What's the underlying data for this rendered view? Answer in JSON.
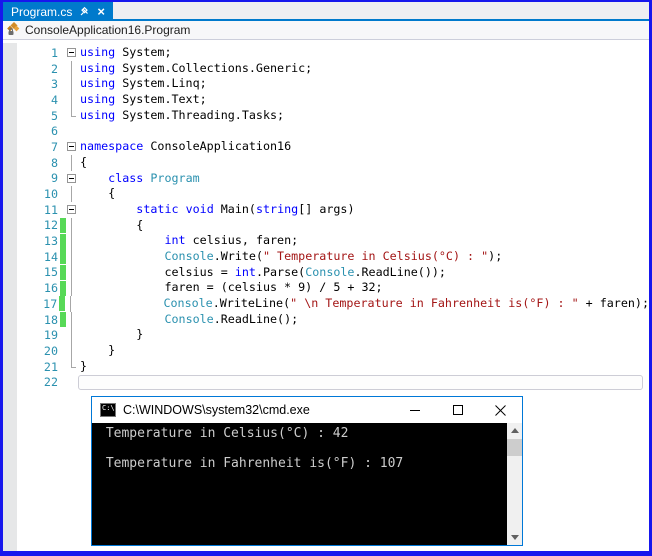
{
  "tab": {
    "label": "Program.cs"
  },
  "breadcrumb": {
    "text": "ConsoleApplication16.Program"
  },
  "colors": {
    "accent_tab": "#007ACC",
    "window_border": "#1717ED",
    "console_border": "#0078D7",
    "keyword": "#0000FF",
    "type": "#2B91AF",
    "string": "#A31515",
    "line_number": "#2B91AF",
    "change_bar": "#57D957",
    "console_text": "#CCCCCC"
  },
  "editor": {
    "lines": [
      {
        "n": "1",
        "fold": "box",
        "tokens": [
          {
            "c": "k",
            "s": "using"
          },
          {
            "c": "p",
            "s": " System;"
          }
        ]
      },
      {
        "n": "2",
        "fold": "v",
        "tokens": [
          {
            "c": "k",
            "s": "using"
          },
          {
            "c": "p",
            "s": " System.Collections.Generic;"
          }
        ]
      },
      {
        "n": "3",
        "fold": "v",
        "tokens": [
          {
            "c": "k",
            "s": "using"
          },
          {
            "c": "p",
            "s": " System.Linq;"
          }
        ]
      },
      {
        "n": "4",
        "fold": "v",
        "tokens": [
          {
            "c": "k",
            "s": "using"
          },
          {
            "c": "p",
            "s": " System.Text;"
          }
        ]
      },
      {
        "n": "5",
        "fold": "end",
        "tokens": [
          {
            "c": "k",
            "s": "using"
          },
          {
            "c": "p",
            "s": " System.Threading.Tasks;"
          }
        ]
      },
      {
        "n": "6",
        "fold": "",
        "tokens": []
      },
      {
        "n": "7",
        "fold": "box",
        "tokens": [
          {
            "c": "k",
            "s": "namespace"
          },
          {
            "c": "p",
            "s": " ConsoleApplication16"
          }
        ]
      },
      {
        "n": "8",
        "fold": "v",
        "tokens": [
          {
            "c": "p",
            "s": "{"
          }
        ]
      },
      {
        "n": "9",
        "fold": "box",
        "tokens": [
          {
            "c": "p",
            "s": "    "
          },
          {
            "c": "k",
            "s": "class"
          },
          {
            "c": "p",
            "s": " "
          },
          {
            "c": "t",
            "s": "Program"
          }
        ]
      },
      {
        "n": "10",
        "fold": "v",
        "tokens": [
          {
            "c": "p",
            "s": "    {"
          }
        ]
      },
      {
        "n": "11",
        "fold": "box",
        "tokens": [
          {
            "c": "p",
            "s": "        "
          },
          {
            "c": "k",
            "s": "static"
          },
          {
            "c": "p",
            "s": " "
          },
          {
            "c": "k",
            "s": "void"
          },
          {
            "c": "p",
            "s": " Main("
          },
          {
            "c": "k",
            "s": "string"
          },
          {
            "c": "p",
            "s": "[] args)"
          }
        ]
      },
      {
        "n": "12",
        "fold": "v",
        "changed": true,
        "tokens": [
          {
            "c": "p",
            "s": "        {"
          }
        ]
      },
      {
        "n": "13",
        "fold": "v",
        "changed": true,
        "tokens": [
          {
            "c": "p",
            "s": "            "
          },
          {
            "c": "k",
            "s": "int"
          },
          {
            "c": "p",
            "s": " celsius, faren;"
          }
        ]
      },
      {
        "n": "14",
        "fold": "v",
        "changed": true,
        "tokens": [
          {
            "c": "p",
            "s": "            "
          },
          {
            "c": "t",
            "s": "Console"
          },
          {
            "c": "p",
            "s": ".Write("
          },
          {
            "c": "s",
            "s": "\" Temperature in Celsius(°C) : \""
          },
          {
            "c": "p",
            "s": ");"
          }
        ]
      },
      {
        "n": "15",
        "fold": "v",
        "changed": true,
        "tokens": [
          {
            "c": "p",
            "s": "            celsius = "
          },
          {
            "c": "k",
            "s": "int"
          },
          {
            "c": "p",
            "s": ".Parse("
          },
          {
            "c": "t",
            "s": "Console"
          },
          {
            "c": "p",
            "s": ".ReadLine());"
          }
        ]
      },
      {
        "n": "16",
        "fold": "v",
        "changed": true,
        "tokens": [
          {
            "c": "p",
            "s": "            faren = (celsius * 9) / 5 + 32;"
          }
        ]
      },
      {
        "n": "17",
        "fold": "v",
        "changed": true,
        "tokens": [
          {
            "c": "p",
            "s": "            "
          },
          {
            "c": "t",
            "s": "Console"
          },
          {
            "c": "p",
            "s": ".WriteLine("
          },
          {
            "c": "s",
            "s": "\" \\n Temperature in Fahrenheit is(°F) : \""
          },
          {
            "c": "p",
            "s": " + faren);"
          }
        ]
      },
      {
        "n": "18",
        "fold": "v",
        "changed": true,
        "tokens": [
          {
            "c": "p",
            "s": "            "
          },
          {
            "c": "t",
            "s": "Console"
          },
          {
            "c": "p",
            "s": ".ReadLine();"
          }
        ]
      },
      {
        "n": "19",
        "fold": "v",
        "tokens": [
          {
            "c": "p",
            "s": "        }"
          }
        ]
      },
      {
        "n": "20",
        "fold": "v",
        "tokens": [
          {
            "c": "p",
            "s": "    }"
          }
        ]
      },
      {
        "n": "21",
        "fold": "end",
        "tokens": [
          {
            "c": "p",
            "s": "}"
          }
        ]
      },
      {
        "n": "22",
        "fold": "",
        "current": true,
        "tokens": []
      }
    ]
  },
  "console": {
    "title": "C:\\WINDOWS\\system32\\cmd.exe",
    "icon_label": "C:\\.",
    "lines": [
      " Temperature in Celsius(°C) : 42",
      "",
      " Temperature in Fahrenheit is(°F) : 107"
    ]
  }
}
